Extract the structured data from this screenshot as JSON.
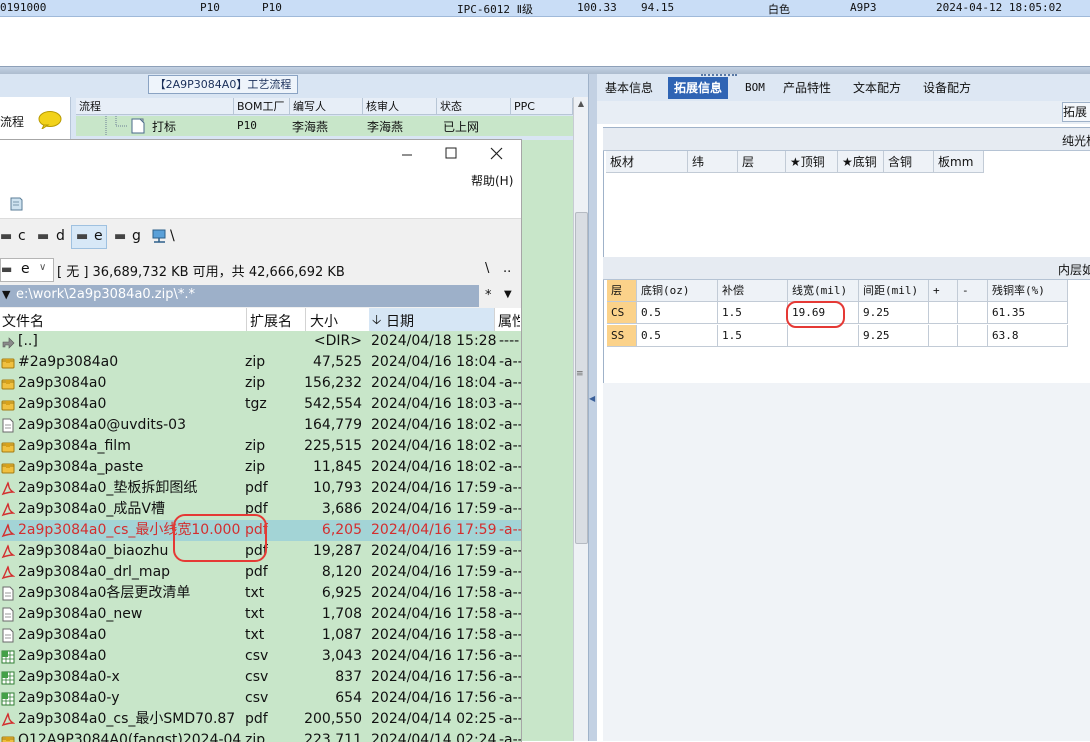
{
  "top_row": {
    "id": "0191000",
    "col1": "P10",
    "col2": "P10",
    "grade": "IPC-6012 Ⅱ级",
    "v1": "100.33",
    "v2": "94.15",
    "color": "白色",
    "code": "A9P3",
    "datetime": "2024-04-12 18:05:02"
  },
  "process": {
    "title": "【2A9P3084A0】工艺流程",
    "left_label": "流程",
    "columns": [
      "流程",
      "BOM工厂",
      "编写人",
      "核审人",
      "状态",
      "PPC"
    ],
    "row": {
      "name": "打标",
      "bom": "P10",
      "writer": "李海燕",
      "reviewer": "李海燕",
      "status": "已上网"
    }
  },
  "file_manager": {
    "help_menu": "帮助(H)",
    "drives": [
      "c",
      "d",
      "e",
      "g",
      "\\"
    ],
    "drive_select": "e",
    "disk_info": "[ 无 ]  36,689,732 KB 可用，共 42,666,692 KB",
    "path_btns": [
      "\\",
      ".."
    ],
    "current_path": "e:\\work\\2a9p3084a0.zip\\*.*",
    "filter": "*",
    "columns": {
      "name": "文件名",
      "ext": "扩展名",
      "size": "大小",
      "date": "日期",
      "attr": "属性"
    },
    "files": [
      {
        "icon": "up",
        "name": "[..]",
        "ext": "",
        "size": "<DIR>",
        "date": "2024/04/18 15:28",
        "attr": "----"
      },
      {
        "icon": "archive",
        "name": "#2a9p3084a0",
        "ext": "zip",
        "size": "47,525",
        "date": "2024/04/16 18:04",
        "attr": "-a--"
      },
      {
        "icon": "archive",
        "name": "2a9p3084a0",
        "ext": "zip",
        "size": "156,232",
        "date": "2024/04/16 18:04",
        "attr": "-a--"
      },
      {
        "icon": "archive",
        "name": "2a9p3084a0",
        "ext": "tgz",
        "size": "542,554",
        "date": "2024/04/16 18:03",
        "attr": "-a--"
      },
      {
        "icon": "doc",
        "name": "2a9p3084a0@uvdits-03",
        "ext": "",
        "size": "164,779",
        "date": "2024/04/16 18:02",
        "attr": "-a--"
      },
      {
        "icon": "archive",
        "name": "2a9p3084a_film",
        "ext": "zip",
        "size": "225,515",
        "date": "2024/04/16 18:02",
        "attr": "-a--"
      },
      {
        "icon": "archive",
        "name": "2a9p3084a_paste",
        "ext": "zip",
        "size": "11,845",
        "date": "2024/04/16 18:02",
        "attr": "-a--"
      },
      {
        "icon": "pdf",
        "name": "2a9p3084a0_垫板拆卸图纸",
        "ext": "pdf",
        "size": "10,793",
        "date": "2024/04/16 17:59",
        "attr": "-a--"
      },
      {
        "icon": "pdf",
        "name": "2a9p3084a0_成品V槽",
        "ext": "pdf",
        "size": "3,686",
        "date": "2024/04/16 17:59",
        "attr": "-a--"
      },
      {
        "icon": "pdf",
        "name": "2a9p3084a0_cs_最小线宽10.000",
        "ext": "pdf",
        "size": "6,205",
        "date": "2024/04/16 17:59",
        "attr": "-a--",
        "selected": true
      },
      {
        "icon": "pdf",
        "name": "2a9p3084a0_biaozhu",
        "ext": "pdf",
        "size": "19,287",
        "date": "2024/04/16 17:59",
        "attr": "-a--"
      },
      {
        "icon": "pdf",
        "name": "2a9p3084a0_drl_map",
        "ext": "pdf",
        "size": "8,120",
        "date": "2024/04/16 17:59",
        "attr": "-a--"
      },
      {
        "icon": "doc",
        "name": "2a9p3084a0各层更改清单",
        "ext": "txt",
        "size": "6,925",
        "date": "2024/04/16 17:58",
        "attr": "-a--"
      },
      {
        "icon": "doc",
        "name": "2a9p3084a0_new",
        "ext": "txt",
        "size": "1,708",
        "date": "2024/04/16 17:58",
        "attr": "-a--"
      },
      {
        "icon": "doc",
        "name": "2a9p3084a0",
        "ext": "txt",
        "size": "1,087",
        "date": "2024/04/16 17:58",
        "attr": "-a--"
      },
      {
        "icon": "csv",
        "name": "2a9p3084a0",
        "ext": "csv",
        "size": "3,043",
        "date": "2024/04/16 17:56",
        "attr": "-a--"
      },
      {
        "icon": "csv",
        "name": "2a9p3084a0-x",
        "ext": "csv",
        "size": "837",
        "date": "2024/04/16 17:56",
        "attr": "-a--"
      },
      {
        "icon": "csv",
        "name": "2a9p3084a0-y",
        "ext": "csv",
        "size": "654",
        "date": "2024/04/16 17:56",
        "attr": "-a--"
      },
      {
        "icon": "pdf",
        "name": "2a9p3084a0_cs_最小SMD70.87",
        "ext": "pdf",
        "size": "200,550",
        "date": "2024/04/14 02:25",
        "attr": "-a--"
      },
      {
        "icon": "archive",
        "name": "Q12A9P3084A0(fangst)2024-04",
        "ext": "zip",
        "size": "223,711",
        "date": "2024/04/14 02:24",
        "attr": "-a--"
      }
    ]
  },
  "right_panel": {
    "tabs": [
      "基本信息",
      "拓展信息",
      "BOM",
      "产品特性",
      "文本配方",
      "设备配方"
    ],
    "active_tab": "拓展信息",
    "ext_button": "拓展",
    "section1_label": "纯光板",
    "material_columns": [
      "板材",
      "纬",
      "层",
      "★顶铜",
      "★底铜",
      "含铜",
      "板mm"
    ],
    "section2_label": "内层如",
    "trace_columns": [
      "层",
      "底铜(oz)",
      "补偿",
      "线宽(mil)",
      "间距(mil)",
      "+",
      "-",
      "残铜率(%)"
    ],
    "trace_rows": [
      [
        "CS",
        "0.5",
        "1.5",
        "19.69",
        "9.25",
        "",
        "",
        "61.35"
      ],
      [
        "SS",
        "0.5",
        "1.5",
        "",
        "9.25",
        "",
        "",
        "63.8"
      ]
    ]
  },
  "colors": {
    "selection_text": "#d32f2f",
    "annotation": "#e53935",
    "list_bg": "#c8e6c9",
    "active_tab": "#2f64b4"
  }
}
